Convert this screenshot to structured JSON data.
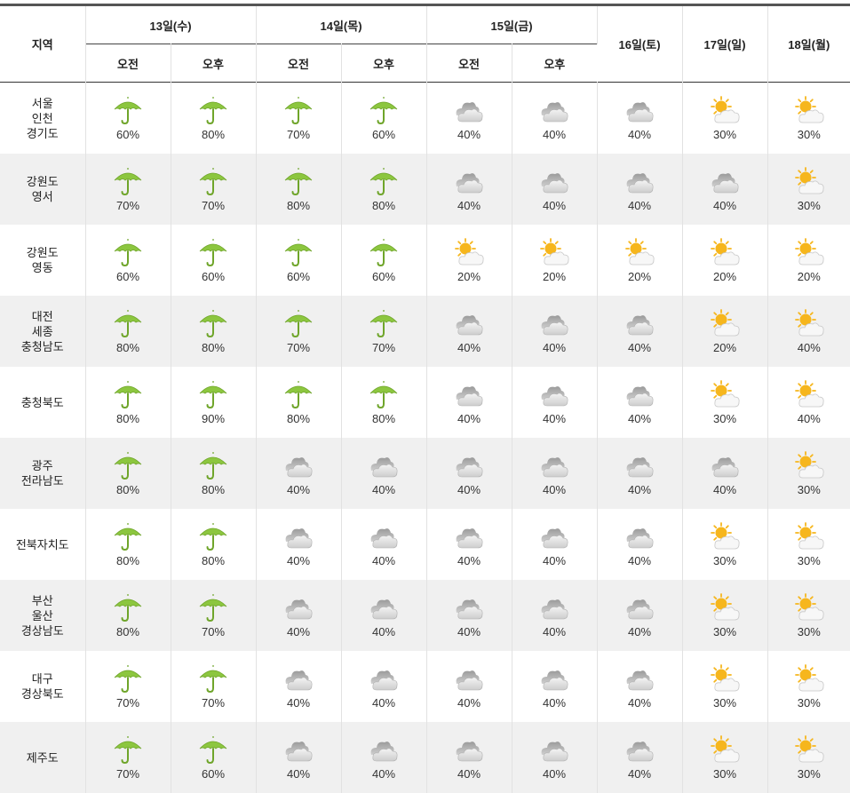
{
  "header": {
    "region_label": "지역",
    "date_groups": [
      {
        "label": "13일(수)",
        "sub": [
          "오전",
          "오후"
        ]
      },
      {
        "label": "14일(목)",
        "sub": [
          "오전",
          "오후"
        ]
      },
      {
        "label": "15일(금)",
        "sub": [
          "오전",
          "오후"
        ]
      }
    ],
    "single_days": [
      "16일(토)",
      "17일(일)",
      "18일(월)"
    ]
  },
  "rows": [
    {
      "region": "서울\n인천\n경기도",
      "cells": [
        {
          "icon": "umbrella-icon",
          "pct": "60%"
        },
        {
          "icon": "umbrella-icon",
          "pct": "80%"
        },
        {
          "icon": "umbrella-icon",
          "pct": "70%"
        },
        {
          "icon": "umbrella-icon",
          "pct": "60%"
        },
        {
          "icon": "cloudy-icon",
          "pct": "40%"
        },
        {
          "icon": "cloudy-icon",
          "pct": "40%"
        },
        {
          "icon": "cloudy-icon",
          "pct": "40%"
        },
        {
          "icon": "partly-cloudy-icon",
          "pct": "30%"
        },
        {
          "icon": "partly-cloudy-icon",
          "pct": "30%"
        }
      ]
    },
    {
      "region": "강원도\n영서",
      "cells": [
        {
          "icon": "umbrella-icon",
          "pct": "70%"
        },
        {
          "icon": "umbrella-icon",
          "pct": "70%"
        },
        {
          "icon": "umbrella-icon",
          "pct": "80%"
        },
        {
          "icon": "umbrella-icon",
          "pct": "80%"
        },
        {
          "icon": "cloudy-icon",
          "pct": "40%"
        },
        {
          "icon": "cloudy-icon",
          "pct": "40%"
        },
        {
          "icon": "cloudy-icon",
          "pct": "40%"
        },
        {
          "icon": "cloudy-icon",
          "pct": "40%"
        },
        {
          "icon": "partly-cloudy-icon",
          "pct": "30%"
        }
      ]
    },
    {
      "region": "강원도\n영동",
      "cells": [
        {
          "icon": "umbrella-icon",
          "pct": "60%"
        },
        {
          "icon": "umbrella-icon",
          "pct": "60%"
        },
        {
          "icon": "umbrella-icon",
          "pct": "60%"
        },
        {
          "icon": "umbrella-icon",
          "pct": "60%"
        },
        {
          "icon": "partly-cloudy-icon",
          "pct": "20%"
        },
        {
          "icon": "partly-cloudy-icon",
          "pct": "20%"
        },
        {
          "icon": "partly-cloudy-icon",
          "pct": "20%"
        },
        {
          "icon": "partly-cloudy-icon",
          "pct": "20%"
        },
        {
          "icon": "partly-cloudy-icon",
          "pct": "20%"
        }
      ]
    },
    {
      "region": "대전\n세종\n충청남도",
      "cells": [
        {
          "icon": "umbrella-icon",
          "pct": "80%"
        },
        {
          "icon": "umbrella-icon",
          "pct": "80%"
        },
        {
          "icon": "umbrella-icon",
          "pct": "70%"
        },
        {
          "icon": "umbrella-icon",
          "pct": "70%"
        },
        {
          "icon": "cloudy-icon",
          "pct": "40%"
        },
        {
          "icon": "cloudy-icon",
          "pct": "40%"
        },
        {
          "icon": "cloudy-icon",
          "pct": "40%"
        },
        {
          "icon": "partly-cloudy-icon",
          "pct": "20%"
        },
        {
          "icon": "partly-cloudy-icon",
          "pct": "40%"
        }
      ]
    },
    {
      "region": "충청북도",
      "cells": [
        {
          "icon": "umbrella-icon",
          "pct": "80%"
        },
        {
          "icon": "umbrella-icon",
          "pct": "90%"
        },
        {
          "icon": "umbrella-icon",
          "pct": "80%"
        },
        {
          "icon": "umbrella-icon",
          "pct": "80%"
        },
        {
          "icon": "cloudy-icon",
          "pct": "40%"
        },
        {
          "icon": "cloudy-icon",
          "pct": "40%"
        },
        {
          "icon": "cloudy-icon",
          "pct": "40%"
        },
        {
          "icon": "partly-cloudy-icon",
          "pct": "30%"
        },
        {
          "icon": "partly-cloudy-icon",
          "pct": "40%"
        }
      ]
    },
    {
      "region": "광주\n전라남도",
      "cells": [
        {
          "icon": "umbrella-icon",
          "pct": "80%"
        },
        {
          "icon": "umbrella-icon",
          "pct": "80%"
        },
        {
          "icon": "cloudy-icon",
          "pct": "40%"
        },
        {
          "icon": "cloudy-icon",
          "pct": "40%"
        },
        {
          "icon": "cloudy-icon",
          "pct": "40%"
        },
        {
          "icon": "cloudy-icon",
          "pct": "40%"
        },
        {
          "icon": "cloudy-icon",
          "pct": "40%"
        },
        {
          "icon": "cloudy-icon",
          "pct": "40%"
        },
        {
          "icon": "partly-cloudy-icon",
          "pct": "30%"
        }
      ]
    },
    {
      "region": "전북자치도",
      "cells": [
        {
          "icon": "umbrella-icon",
          "pct": "80%"
        },
        {
          "icon": "umbrella-icon",
          "pct": "80%"
        },
        {
          "icon": "cloudy-icon",
          "pct": "40%"
        },
        {
          "icon": "cloudy-icon",
          "pct": "40%"
        },
        {
          "icon": "cloudy-icon",
          "pct": "40%"
        },
        {
          "icon": "cloudy-icon",
          "pct": "40%"
        },
        {
          "icon": "cloudy-icon",
          "pct": "40%"
        },
        {
          "icon": "partly-cloudy-icon",
          "pct": "30%"
        },
        {
          "icon": "partly-cloudy-icon",
          "pct": "30%"
        }
      ]
    },
    {
      "region": "부산\n울산\n경상남도",
      "cells": [
        {
          "icon": "umbrella-icon",
          "pct": "80%"
        },
        {
          "icon": "umbrella-icon",
          "pct": "70%"
        },
        {
          "icon": "cloudy-icon",
          "pct": "40%"
        },
        {
          "icon": "cloudy-icon",
          "pct": "40%"
        },
        {
          "icon": "cloudy-icon",
          "pct": "40%"
        },
        {
          "icon": "cloudy-icon",
          "pct": "40%"
        },
        {
          "icon": "cloudy-icon",
          "pct": "40%"
        },
        {
          "icon": "partly-cloudy-icon",
          "pct": "30%"
        },
        {
          "icon": "partly-cloudy-icon",
          "pct": "30%"
        }
      ]
    },
    {
      "region": "대구\n경상북도",
      "cells": [
        {
          "icon": "umbrella-icon",
          "pct": "70%"
        },
        {
          "icon": "umbrella-icon",
          "pct": "70%"
        },
        {
          "icon": "cloudy-icon",
          "pct": "40%"
        },
        {
          "icon": "cloudy-icon",
          "pct": "40%"
        },
        {
          "icon": "cloudy-icon",
          "pct": "40%"
        },
        {
          "icon": "cloudy-icon",
          "pct": "40%"
        },
        {
          "icon": "cloudy-icon",
          "pct": "40%"
        },
        {
          "icon": "partly-cloudy-icon",
          "pct": "30%"
        },
        {
          "icon": "partly-cloudy-icon",
          "pct": "30%"
        }
      ]
    },
    {
      "region": "제주도",
      "cells": [
        {
          "icon": "umbrella-icon",
          "pct": "70%"
        },
        {
          "icon": "umbrella-icon",
          "pct": "60%"
        },
        {
          "icon": "cloudy-icon",
          "pct": "40%"
        },
        {
          "icon": "cloudy-icon",
          "pct": "40%"
        },
        {
          "icon": "cloudy-icon",
          "pct": "40%"
        },
        {
          "icon": "cloudy-icon",
          "pct": "40%"
        },
        {
          "icon": "cloudy-icon",
          "pct": "40%"
        },
        {
          "icon": "partly-cloudy-icon",
          "pct": "30%"
        },
        {
          "icon": "partly-cloudy-icon",
          "pct": "30%"
        }
      ]
    }
  ],
  "colors": {
    "umbrella": "#8cc63f",
    "umbrella_dark": "#6fa52a",
    "cloud_gray": "#b8b8b8",
    "cloud_light": "#e8e8e8",
    "sun": "#f6b61d",
    "row_alt_bg": "#f0f0f0"
  }
}
